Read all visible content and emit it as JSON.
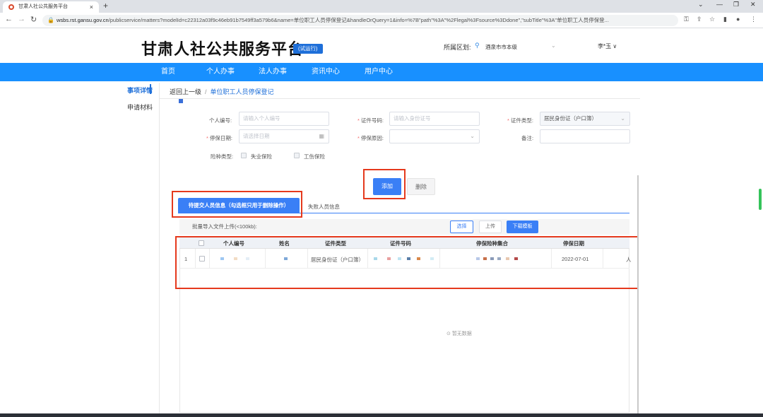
{
  "browser": {
    "tab_title": "甘肃人社公共服务平台",
    "tab_close": "×",
    "new_tab": "+",
    "url_host": "wsbs.rst.gansu.gov.cn",
    "url_path": "/publicservice/matters?modelId=c22312a03f9c46eb91b7549ff3a579b6&name=单位职工人员停保登记&handleOrQuery=1&info=%7B\"path\"%3A\"%2Flegal%3Fsource%3Ddone\",\"subTitle\"%3A\"单位职工人员停保登..."
  },
  "header": {
    "title": "甘肃人社公共服务平台",
    "badge": "(试运行)",
    "region_label": "所属区划:",
    "region_value": "酒泉市市本级",
    "user": "李*玉 ∨"
  },
  "nav": [
    "首页",
    "个人办事",
    "法人办事",
    "资讯中心",
    "用户中心"
  ],
  "sidebar": [
    "事项详情",
    "申请材料"
  ],
  "breadcrumb": {
    "back": "返回上一级",
    "sep": "/",
    "current": "单位职工人员停保登记"
  },
  "form": {
    "person_id": {
      "label": "个人编号:",
      "placeholder": "请输入个人编号"
    },
    "cert_no": {
      "label": "证件号码:",
      "placeholder": "请输入身份证号"
    },
    "cert_type": {
      "label": "证件类型:",
      "value": "居民身份证（户口簿）"
    },
    "stop_date": {
      "label": "停保日期:",
      "placeholder": "请选择日期"
    },
    "stop_reason": {
      "label": "停保原因:",
      "placeholder": ""
    },
    "remark": {
      "label": "备注:",
      "placeholder": ""
    },
    "insurance_type": {
      "label": "险种类型:",
      "options": [
        "失业保险",
        "工伤保险"
      ]
    },
    "required_mark": "*"
  },
  "actions": {
    "add": "添加",
    "delete": "删除"
  },
  "tabs": {
    "pending": "待提交人员信息（勾选框只用于删除操作）",
    "failed": "失败人员信息"
  },
  "upload": {
    "label": "批量导入文件上传(<100kb):",
    "choose": "选择",
    "upload": "上传",
    "template": "下载模板"
  },
  "table": {
    "columns": [
      "个人编号",
      "姓名",
      "证件类型",
      "证件号码",
      "停保险种集合",
      "停保日期"
    ],
    "rows": [
      {
        "index": "1",
        "cert_type": "居民身份证（户口簿）",
        "stop_date": "2022-07-01",
        "overflow": "人"
      }
    ],
    "empty_text": "暂无数据"
  }
}
